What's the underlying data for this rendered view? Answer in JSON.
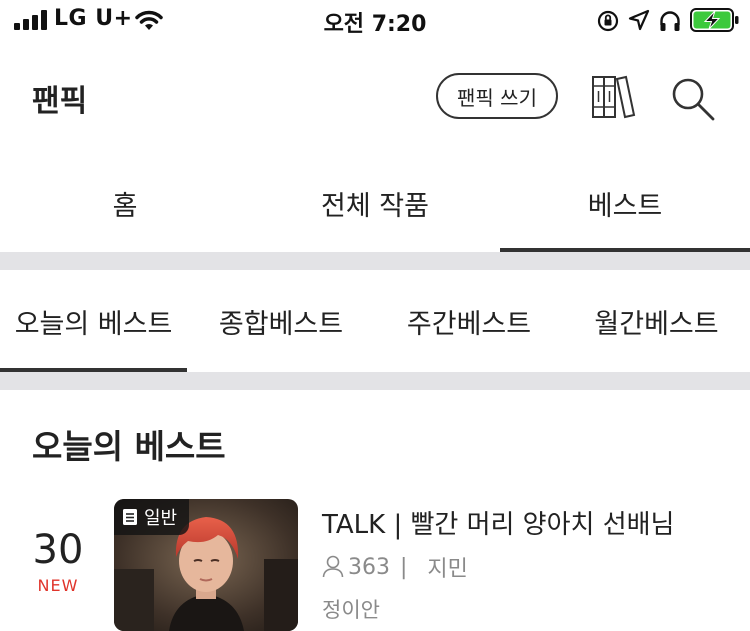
{
  "status_bar": {
    "carrier": "LG U+",
    "time": "오전 7:20"
  },
  "header": {
    "title": "팬픽",
    "write_button": "팬픽 쓰기"
  },
  "main_tabs": [
    {
      "label": "홈",
      "active": false
    },
    {
      "label": "전체 작품",
      "active": false
    },
    {
      "label": "베스트",
      "active": true
    }
  ],
  "sub_tabs": [
    {
      "label": "오늘의 베스트",
      "active": true
    },
    {
      "label": "종합베스트",
      "active": false
    },
    {
      "label": "주간베스트",
      "active": false
    },
    {
      "label": "월간베스트",
      "active": false
    }
  ],
  "section": {
    "title": "오늘의 베스트"
  },
  "items": [
    {
      "rank": "30",
      "rank_status": "NEW",
      "badge": "일반",
      "title": "TALK | 빨간 머리 양아치 선배님",
      "views": "363",
      "separator": "|",
      "tag": "지민",
      "author": "정이안"
    }
  ],
  "colors": {
    "accent_new": "#e0342b",
    "divider": "#e3e3e6",
    "battery_green": "#3cc93c",
    "text_primary": "#222222",
    "text_muted": "#8a8a8a"
  },
  "icons": {
    "library": "library-icon",
    "search": "search-icon",
    "user": "user-icon",
    "document": "document-icon"
  }
}
